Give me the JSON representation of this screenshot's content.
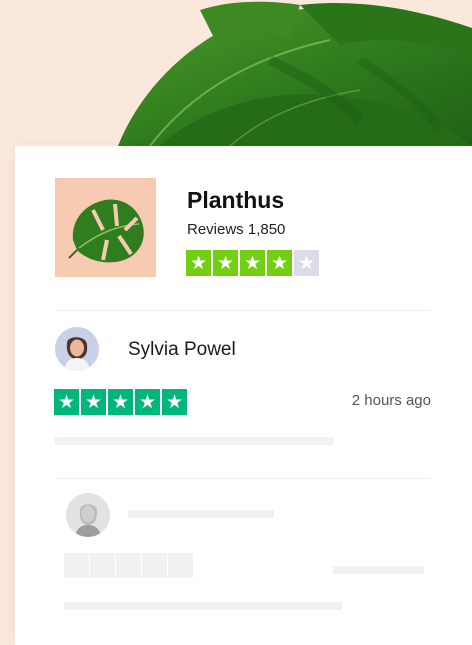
{
  "business": {
    "name": "Planthus",
    "reviews_label": "Reviews 1,850",
    "rating_stars": 4,
    "max_stars": 5,
    "logo_icon": "monstera-leaf-icon"
  },
  "review": {
    "reviewer_name": "Sylvia Powel",
    "time": "2 hours ago",
    "rating_stars": 5,
    "star_glyph": "★"
  },
  "colors": {
    "background": "#fbe8dd",
    "logo_bg": "#f6cbb1",
    "business_star": "#73cf11",
    "review_star": "#00b67a",
    "empty_star": "#dcdce6",
    "skeleton": "#f1f1f1"
  }
}
